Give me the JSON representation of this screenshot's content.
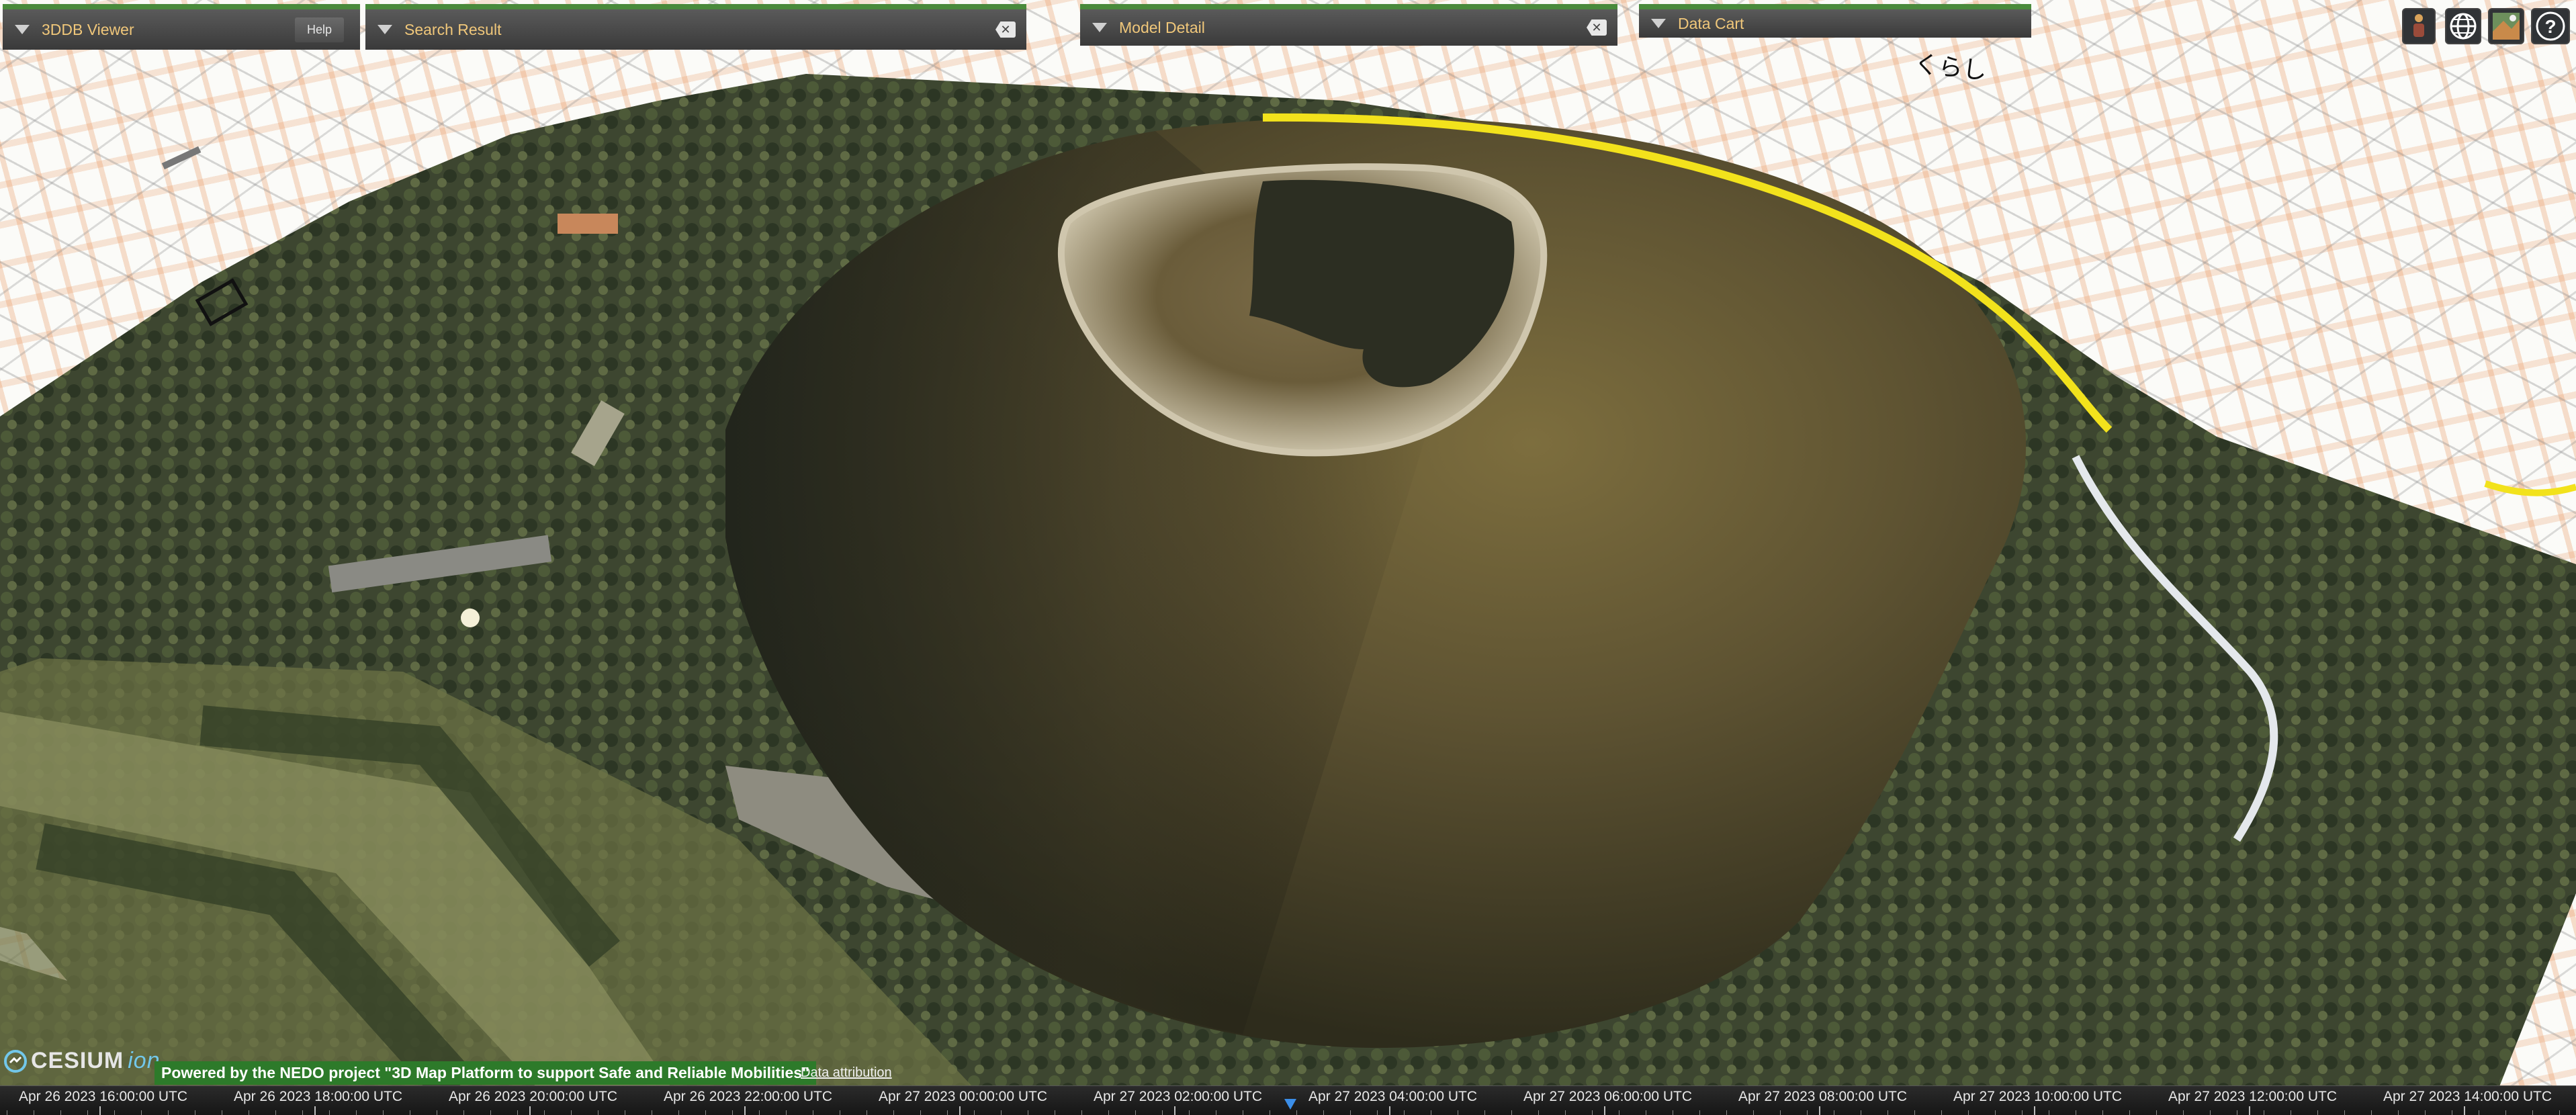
{
  "panels": {
    "viewer": {
      "title": "3DDB Viewer",
      "help_label": "Help"
    },
    "search": {
      "title": "Search Result",
      "close_label": "✕"
    },
    "model": {
      "title": "Model Detail",
      "close_label": "✕"
    },
    "cart": {
      "title": "Data Cart"
    }
  },
  "toolbar": {
    "icons": [
      "person-icon",
      "globe-icon",
      "layers-map-icon",
      "help-icon"
    ],
    "help_glyph": "?"
  },
  "map": {
    "annotation_text": "くらし",
    "colors": {
      "road": "#8c8c8c",
      "building": "#e68c50",
      "route_highlight": "#f2e21c"
    }
  },
  "credits": {
    "cesium_logo": "CESIUM",
    "cesium_ion": "ion",
    "nedo": "Powered by the NEDO project \"3D Map Platform to support Safe and Reliable Mobilities\"",
    "attribution": "Data attribution"
  },
  "timeline": {
    "labels": [
      "Apr 26 2023 16:00:00 UTC",
      "Apr 26 2023 18:00:00 UTC",
      "Apr 26 2023 20:00:00 UTC",
      "Apr 26 2023 22:00:00 UTC",
      "Apr 27 2023 00:00:00 UTC",
      "Apr 27 2023 02:00:00 UTC",
      "Apr 27 2023 04:00:00 UTC",
      "Apr 27 2023 06:00:00 UTC",
      "Apr 27 2023 08:00:00 UTC",
      "Apr 27 2023 10:00:00 UTC",
      "Apr 27 2023 12:00:00 UTC",
      "Apr 27 2023 14:00:00 UTC"
    ]
  }
}
